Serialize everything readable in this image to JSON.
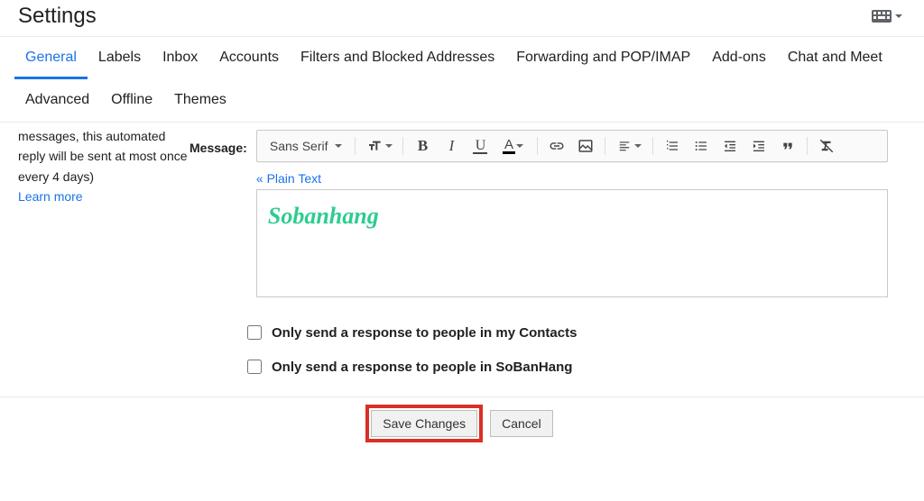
{
  "header": {
    "title": "Settings"
  },
  "tabs": {
    "row1": [
      "General",
      "Labels",
      "Inbox",
      "Accounts",
      "Filters and Blocked Addresses",
      "Forwarding and POP/IMAP",
      "Add-ons",
      "Chat and Meet"
    ],
    "row2": [
      "Advanced",
      "Offline",
      "Themes"
    ],
    "active": "General"
  },
  "side": {
    "text1": "messages, this automated reply will be sent at most once every 4 days)",
    "learn": "Learn more"
  },
  "editor": {
    "label": "Message:",
    "font": "Sans Serif",
    "plain": "« Plain Text",
    "signature": "Sobanhang"
  },
  "checks": {
    "c1": "Only send a response to people in my Contacts",
    "c2": "Only send a response to people in SoBanHang"
  },
  "footer": {
    "save": "Save Changes",
    "cancel": "Cancel"
  }
}
